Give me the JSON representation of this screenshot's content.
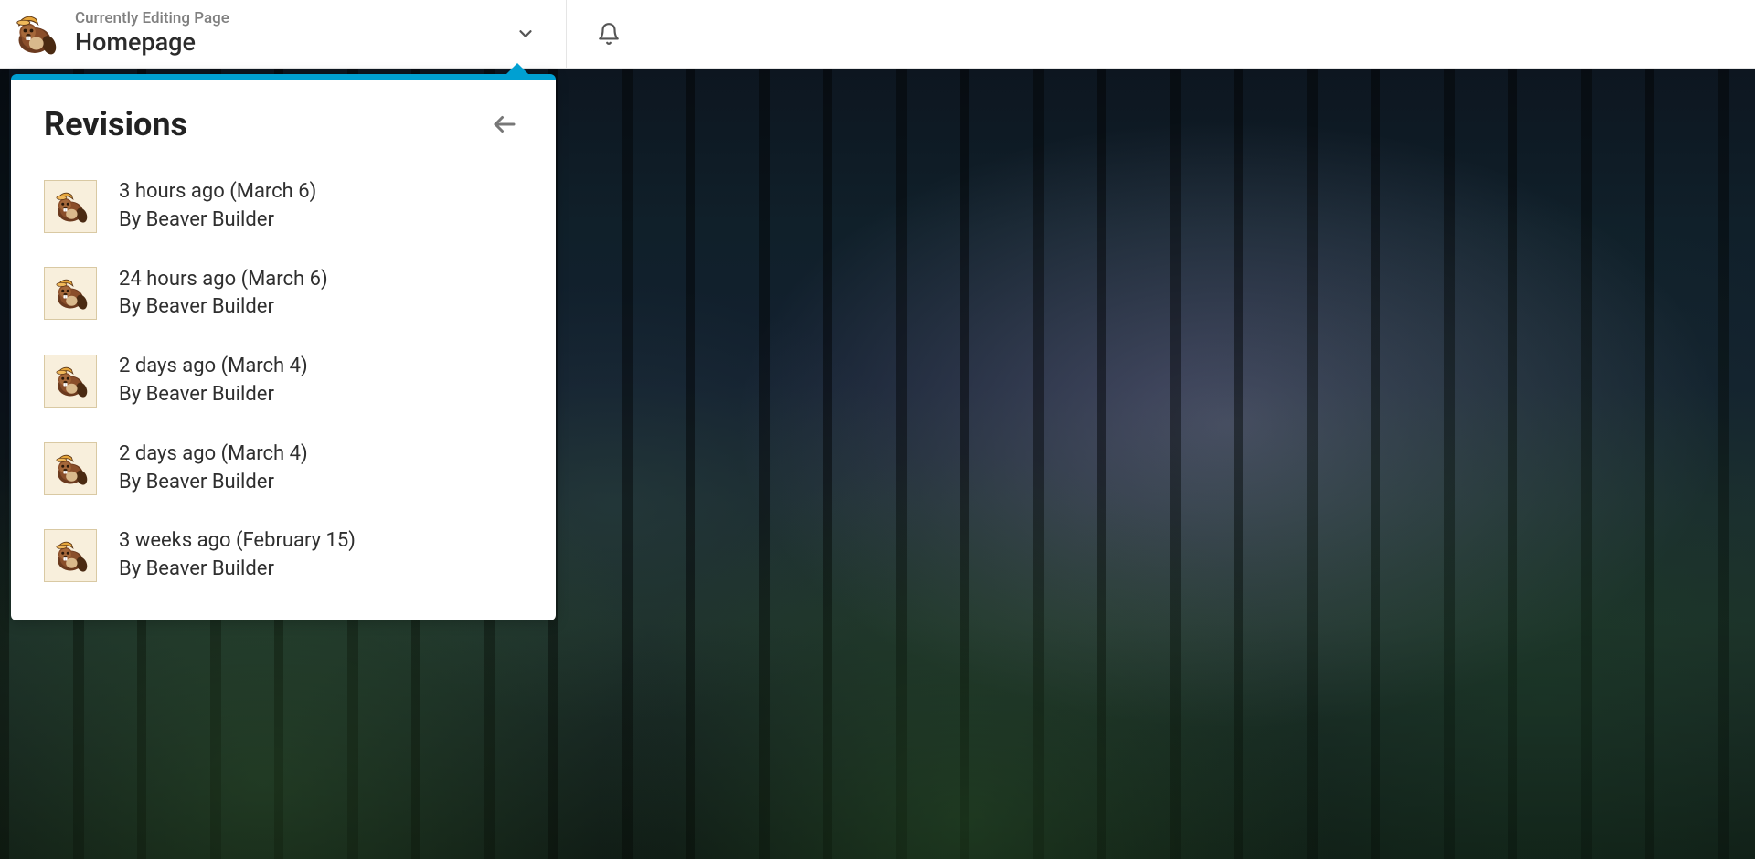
{
  "topbar": {
    "editing_label": "Currently Editing Page",
    "page_title": "Homepage"
  },
  "panel": {
    "title": "Revisions"
  },
  "revisions": [
    {
      "time": "3 hours ago (March 6)",
      "author": "By Beaver Builder"
    },
    {
      "time": "24 hours ago (March 6)",
      "author": "By Beaver Builder"
    },
    {
      "time": "2 days ago (March 4)",
      "author": "By Beaver Builder"
    },
    {
      "time": "2 days ago (March 4)",
      "author": "By Beaver Builder"
    },
    {
      "time": "3 weeks ago (February 15)",
      "author": "By Beaver Builder"
    }
  ],
  "colors": {
    "accent": "#00A0D2"
  }
}
